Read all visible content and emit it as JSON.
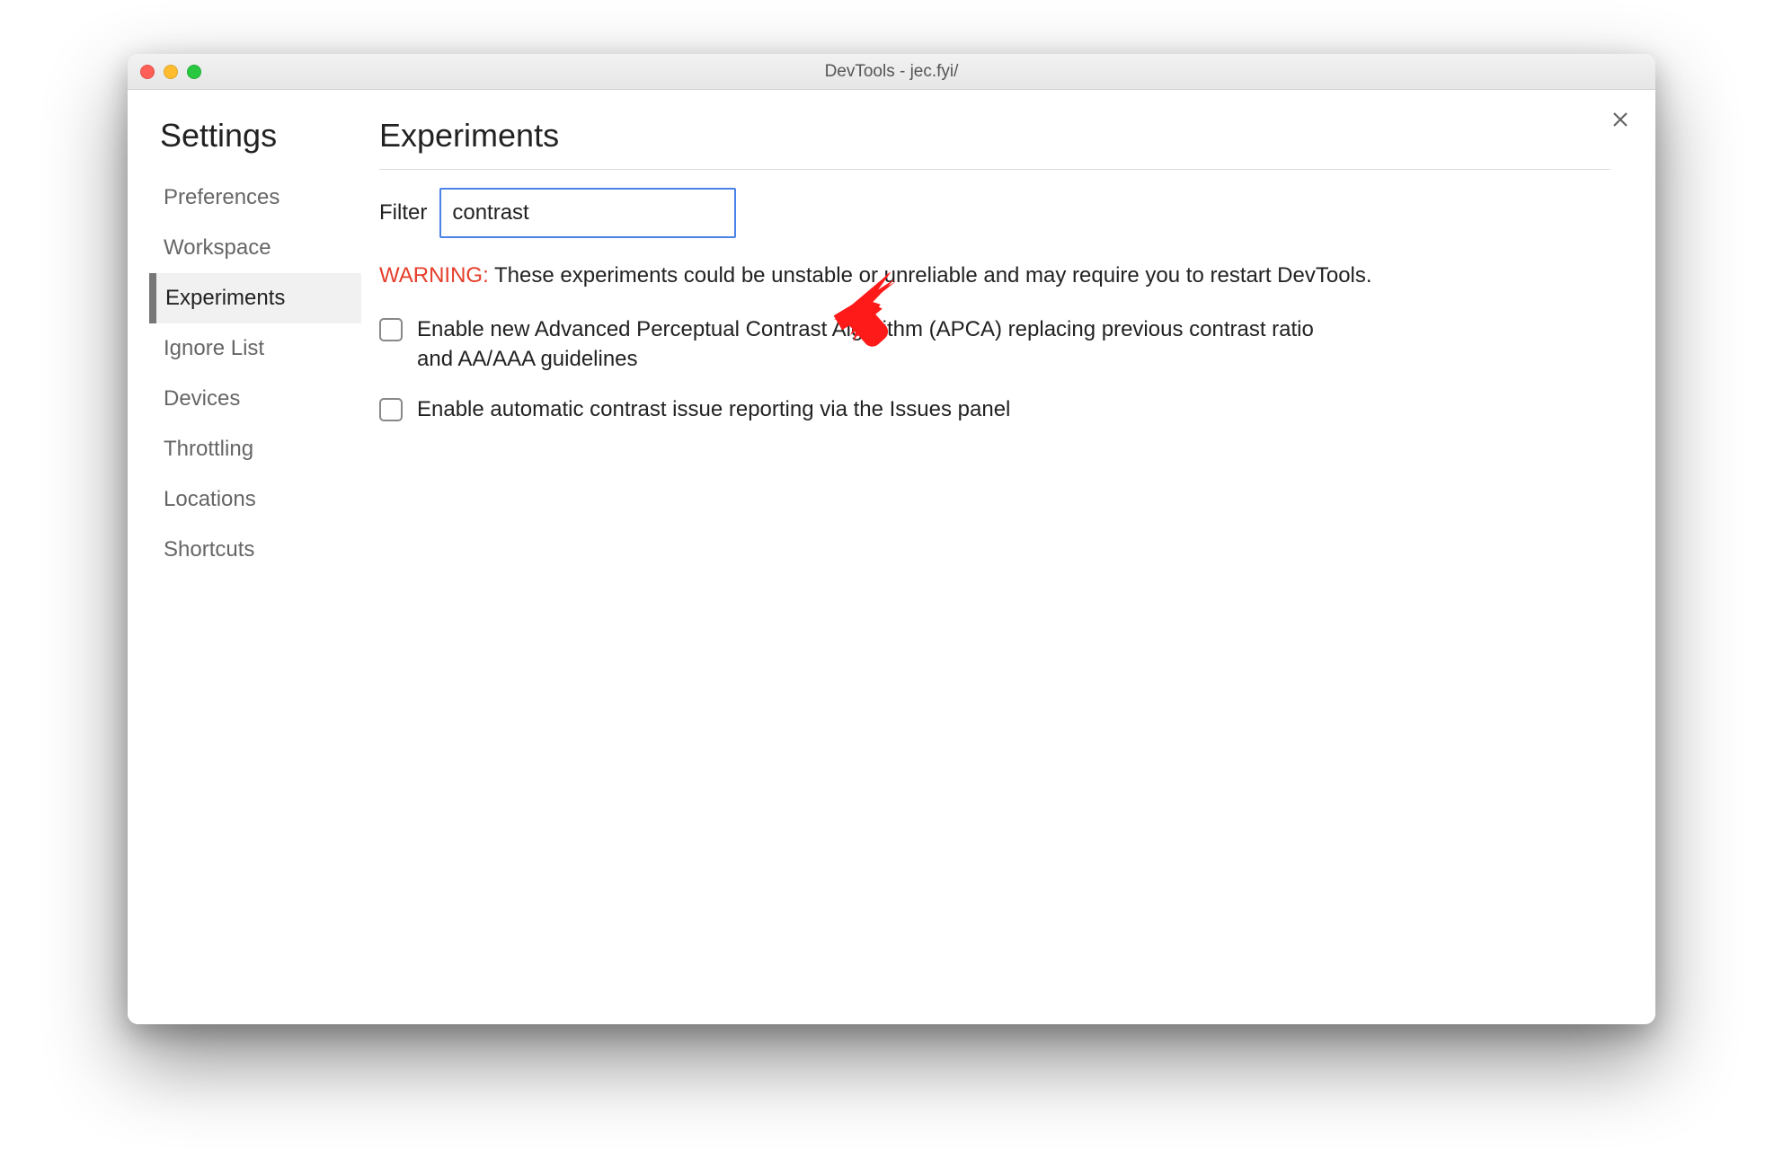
{
  "window": {
    "title": "DevTools - jec.fyi/"
  },
  "sidebar": {
    "title": "Settings",
    "items": [
      {
        "label": "Preferences",
        "active": false
      },
      {
        "label": "Workspace",
        "active": false
      },
      {
        "label": "Experiments",
        "active": true
      },
      {
        "label": "Ignore List",
        "active": false
      },
      {
        "label": "Devices",
        "active": false
      },
      {
        "label": "Throttling",
        "active": false
      },
      {
        "label": "Locations",
        "active": false
      },
      {
        "label": "Shortcuts",
        "active": false
      }
    ]
  },
  "main": {
    "title": "Experiments",
    "filter_label": "Filter",
    "filter_value": "contrast",
    "warning_prefix": "WARNING:",
    "warning_text": " These experiments could be unstable or unreliable and may require you to restart DevTools.",
    "experiments": [
      {
        "label": "Enable new Advanced Perceptual Contrast Algorithm (APCA) replacing previous contrast ratio and AA/AAA guidelines"
      },
      {
        "label": "Enable automatic contrast issue reporting via the Issues panel"
      }
    ]
  },
  "annotation": {
    "arrow_color": "#ff1a1a"
  }
}
